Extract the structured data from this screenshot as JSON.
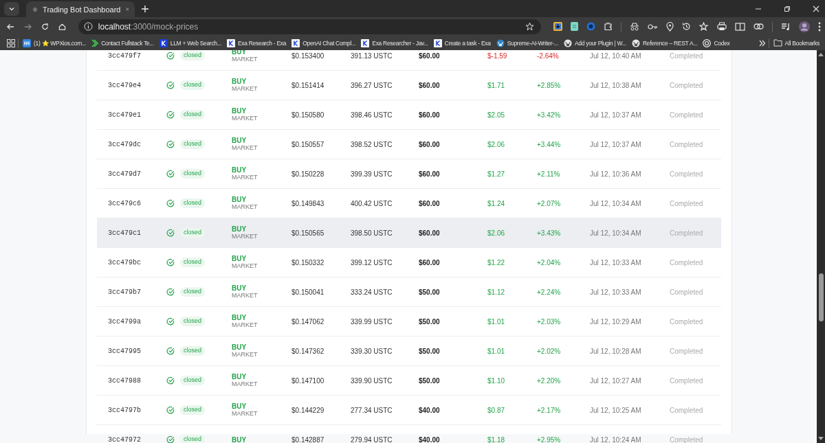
{
  "browser": {
    "tab": {
      "title": "Trading Bot Dashboard"
    },
    "url": {
      "host": "localhost",
      "rest": ":3000/mock-prices"
    },
    "bookmarks": [
      {
        "label": "(1) ⭐ WPXios.com...",
        "kind": "tile"
      },
      {
        "label": "Contact Fullstack Te...",
        "kind": "chevron"
      },
      {
        "label": "LLM + Web Search...",
        "kind": "kdark"
      },
      {
        "label": "Exa Research - Exa",
        "kind": "k"
      },
      {
        "label": "OpenAI Chat Compl...",
        "kind": "k"
      },
      {
        "label": "Exa Researcher - Jav...",
        "kind": "k"
      },
      {
        "label": "Create a task - Exa",
        "kind": "k"
      },
      {
        "label": "Supreme-AI-Writer-...",
        "kind": "wpblue"
      },
      {
        "label": "Add your Plugin | W...",
        "kind": "wp"
      },
      {
        "label": "Reference – REST A...",
        "kind": "wp"
      },
      {
        "label": "Codex",
        "kind": "ring"
      }
    ],
    "all_bookmarks": "All Bookmarks"
  },
  "trades": [
    {
      "id": "3cc479f7",
      "status": "closed",
      "side": "BUY",
      "order_type": "MARKET",
      "price": "$0.153400",
      "quantity": "391.13 USTC",
      "total": "$60.00",
      "pnl": "$-1.59",
      "pnl_pct": "-2.64%",
      "loss": true,
      "time": "Jul 12, 10:40 AM",
      "result": "Completed",
      "selected": false
    },
    {
      "id": "3cc479e4",
      "status": "closed",
      "side": "BUY",
      "order_type": "MARKET",
      "price": "$0.151414",
      "quantity": "396.27 USTC",
      "total": "$60.00",
      "pnl": "$1.71",
      "pnl_pct": "+2.85%",
      "loss": false,
      "time": "Jul 12, 10:38 AM",
      "result": "Completed",
      "selected": false
    },
    {
      "id": "3cc479e1",
      "status": "closed",
      "side": "BUY",
      "order_type": "MARKET",
      "price": "$0.150580",
      "quantity": "398.46 USTC",
      "total": "$60.00",
      "pnl": "$2.05",
      "pnl_pct": "+3.42%",
      "loss": false,
      "time": "Jul 12, 10:37 AM",
      "result": "Completed",
      "selected": false
    },
    {
      "id": "3cc479dc",
      "status": "closed",
      "side": "BUY",
      "order_type": "MARKET",
      "price": "$0.150557",
      "quantity": "398.52 USTC",
      "total": "$60.00",
      "pnl": "$2.06",
      "pnl_pct": "+3.44%",
      "loss": false,
      "time": "Jul 12, 10:37 AM",
      "result": "Completed",
      "selected": false
    },
    {
      "id": "3cc479d7",
      "status": "closed",
      "side": "BUY",
      "order_type": "MARKET",
      "price": "$0.150228",
      "quantity": "399.39 USTC",
      "total": "$60.00",
      "pnl": "$1.27",
      "pnl_pct": "+2.11%",
      "loss": false,
      "time": "Jul 12, 10:36 AM",
      "result": "Completed",
      "selected": false
    },
    {
      "id": "3cc479c6",
      "status": "closed",
      "side": "BUY",
      "order_type": "MARKET",
      "price": "$0.149843",
      "quantity": "400.42 USTC",
      "total": "$60.00",
      "pnl": "$1.24",
      "pnl_pct": "+2.07%",
      "loss": false,
      "time": "Jul 12, 10:34 AM",
      "result": "Completed",
      "selected": false
    },
    {
      "id": "3cc479c1",
      "status": "closed",
      "side": "BUY",
      "order_type": "MARKET",
      "price": "$0.150565",
      "quantity": "398.50 USTC",
      "total": "$60.00",
      "pnl": "$2.06",
      "pnl_pct": "+3.43%",
      "loss": false,
      "time": "Jul 12, 10:34 AM",
      "result": "Completed",
      "selected": true
    },
    {
      "id": "3cc479bc",
      "status": "closed",
      "side": "BUY",
      "order_type": "MARKET",
      "price": "$0.150332",
      "quantity": "399.12 USTC",
      "total": "$60.00",
      "pnl": "$1.22",
      "pnl_pct": "+2.04%",
      "loss": false,
      "time": "Jul 12, 10:33 AM",
      "result": "Completed",
      "selected": false
    },
    {
      "id": "3cc479b7",
      "status": "closed",
      "side": "BUY",
      "order_type": "MARKET",
      "price": "$0.150041",
      "quantity": "333.24 USTC",
      "total": "$50.00",
      "pnl": "$1.12",
      "pnl_pct": "+2.24%",
      "loss": false,
      "time": "Jul 12, 10:33 AM",
      "result": "Completed",
      "selected": false
    },
    {
      "id": "3cc4799a",
      "status": "closed",
      "side": "BUY",
      "order_type": "MARKET",
      "price": "$0.147062",
      "quantity": "339.99 USTC",
      "total": "$50.00",
      "pnl": "$1.01",
      "pnl_pct": "+2.03%",
      "loss": false,
      "time": "Jul 12, 10:29 AM",
      "result": "Completed",
      "selected": false
    },
    {
      "id": "3cc47995",
      "status": "closed",
      "side": "BUY",
      "order_type": "MARKET",
      "price": "$0.147362",
      "quantity": "339.30 USTC",
      "total": "$50.00",
      "pnl": "$1.01",
      "pnl_pct": "+2.02%",
      "loss": false,
      "time": "Jul 12, 10:28 AM",
      "result": "Completed",
      "selected": false
    },
    {
      "id": "3cc47988",
      "status": "closed",
      "side": "BUY",
      "order_type": "MARKET",
      "price": "$0.147100",
      "quantity": "339.90 USTC",
      "total": "$50.00",
      "pnl": "$1.10",
      "pnl_pct": "+2.20%",
      "loss": false,
      "time": "Jul 12, 10:27 AM",
      "result": "Completed",
      "selected": false
    },
    {
      "id": "3cc4797b",
      "status": "closed",
      "side": "BUY",
      "order_type": "MARKET",
      "price": "$0.144229",
      "quantity": "277.34 USTC",
      "total": "$40.00",
      "pnl": "$0.87",
      "pnl_pct": "+2.17%",
      "loss": false,
      "time": "Jul 12, 10:25 AM",
      "result": "Completed",
      "selected": false
    },
    {
      "id": "3cc47972",
      "status": "closed",
      "side": "BUY",
      "price": "$0.142887",
      "quantity": "279.94 USTC",
      "total": "$40.00",
      "pnl": "$1.18",
      "pnl_pct": "+2.95%",
      "loss": false,
      "time": "Jul 12, 10:24 AM",
      "result": "Completed",
      "selected": false
    }
  ]
}
